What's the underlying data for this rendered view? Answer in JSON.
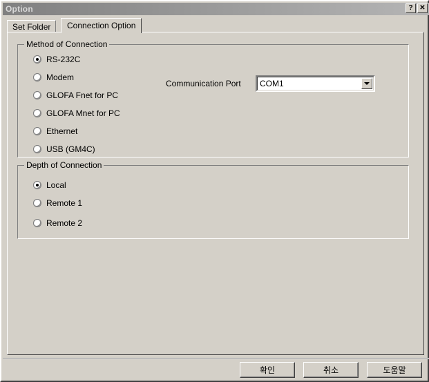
{
  "window": {
    "title": "Option",
    "help_button": "?",
    "close_button": "✕"
  },
  "tabs": [
    {
      "label": "Set Folder",
      "active": false
    },
    {
      "label": "Connection Option",
      "active": true
    }
  ],
  "method_group": {
    "title": "Method of Connection",
    "options": [
      {
        "label": "RS-232C",
        "selected": true
      },
      {
        "label": "Modem",
        "selected": false
      },
      {
        "label": "GLOFA Fnet for PC",
        "selected": false
      },
      {
        "label": "GLOFA Mnet for PC",
        "selected": false
      },
      {
        "label": "Ethernet",
        "selected": false
      },
      {
        "label": "USB (GM4C)",
        "selected": false
      }
    ],
    "comm_port": {
      "label": "Communication Port",
      "value": "COM1"
    }
  },
  "depth_group": {
    "title": "Depth of Connection",
    "options": [
      {
        "label": "Local",
        "selected": true
      },
      {
        "label": "Remote 1",
        "selected": false
      },
      {
        "label": "Remote 2",
        "selected": false
      }
    ]
  },
  "footer": {
    "ok": "확인",
    "cancel": "취소",
    "help": "도움말"
  },
  "colors": {
    "face": "#d4d0c8",
    "shadow": "#808080",
    "dark": "#404040",
    "light": "#ffffff",
    "title_left": "#808080",
    "title_right": "#b5b5b5",
    "title_text": "#d8d8d8"
  }
}
